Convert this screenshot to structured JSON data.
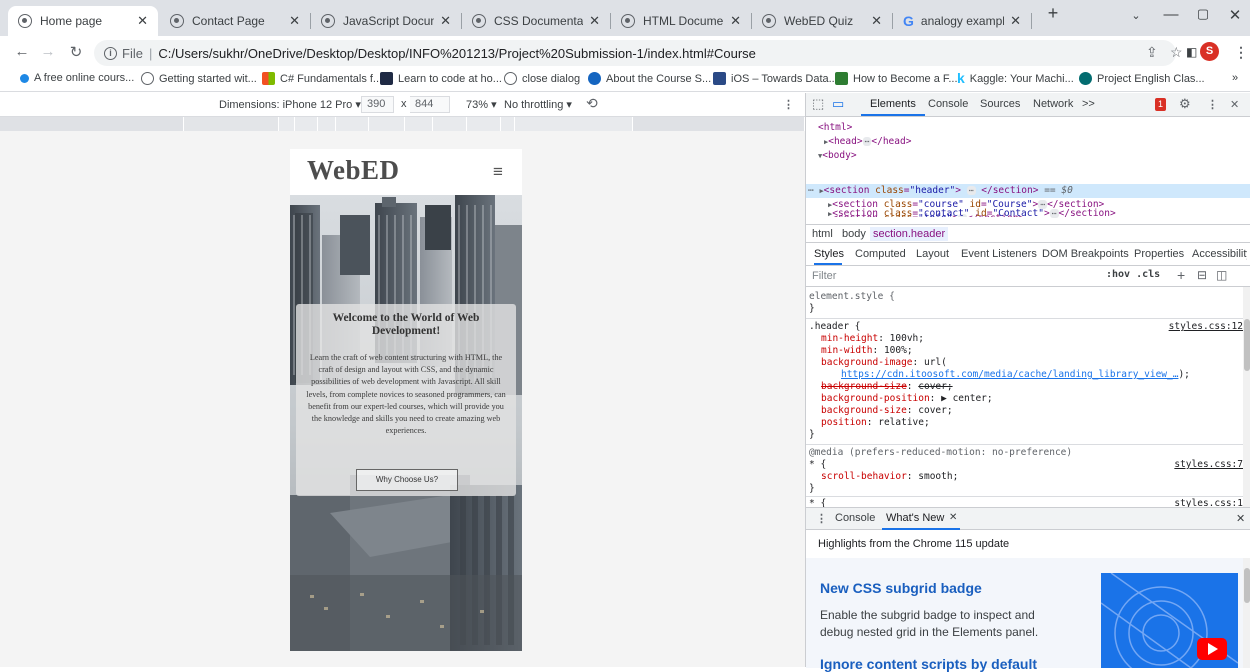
{
  "browser": {
    "tabs": [
      {
        "title": "Home page",
        "active": true
      },
      {
        "title": "Contact Page"
      },
      {
        "title": "JavaScript Documentati"
      },
      {
        "title": "CSS Documentation"
      },
      {
        "title": "HTML Documentation"
      },
      {
        "title": "WebED Quiz"
      },
      {
        "title": "analogy examples - G"
      }
    ],
    "new_tab": "+",
    "address": {
      "prefix": "File",
      "separator": "|",
      "url": "C:/Users/sukhr/OneDrive/Desktop/Desktop/INFO%201213/Project%20Submission-1/index.html#Course"
    },
    "profile_initial": "S",
    "bookmarks": [
      "A free online cours...",
      "Getting started wit...",
      "C# Fundamentals f...",
      "Learn to code at ho...",
      "close dialog",
      "About the Course S...",
      "iOS – Towards Data...",
      "How to Become a F...",
      "Kaggle: Your Machi...",
      "Project English Clas..."
    ],
    "bookmarks_overflow": "»"
  },
  "device_toolbar": {
    "dimensions_label": "Dimensions: iPhone 12 Pro ▾",
    "width": "390",
    "times": "x",
    "height": "844",
    "zoom": "73% ▾",
    "throttling": "No throttling ▾"
  },
  "site": {
    "logo": "WebED",
    "menu_icon": "≡",
    "hero_title": "Welcome to the World of Web Development!",
    "hero_text": "Learn the craft of web content structuring with HTML, the craft of design and layout with CSS, and the dynamic possibilities of web development with Javascript. All skill levels, from complete novices to seasoned programmers, can benefit from our expert-led courses, which will provide you the knowledge and skills you need to create amazing web experiences.",
    "hero_button": "Why Choose Us?"
  },
  "devtools": {
    "tabs": [
      "Elements",
      "Console",
      "Sources",
      "Network",
      ">>"
    ],
    "error_count": "1",
    "dom": {
      "l1": "<html>",
      "l2a": "<head>",
      "l2b": "</head>",
      "l3": "<body>",
      "selected_tail": "== $0"
    },
    "breadcrumbs": [
      "html",
      "body",
      "section.header"
    ],
    "style_tabs": [
      "Styles",
      "Computed",
      "Layout",
      "Event Listeners",
      "DOM Breakpoints",
      "Properties",
      "Accessibility"
    ],
    "filter_placeholder": "Filter",
    "filter_tools": ":hov .cls",
    "rules": {
      "element_style": "element.style {",
      "close": "}",
      "header_selector": ".header {",
      "header_src": "styles.css:12",
      "p1n": "min-height",
      "p1v": "100vh;",
      "p2n": "min-width",
      "p2v": "100%;",
      "p3n": "background-image",
      "p3v": "url(",
      "url": "https://cdn.itoosoft.com/media/cache/landing_library_view_…",
      "url_end": ");",
      "p4n": "background-size",
      "p4v": "cover;",
      "p5n": "background-position",
      "p5v": "▶ center;",
      "p6n": "background-size",
      "p6v": "cover;",
      "p7n": "position",
      "p7v": "relative;",
      "media": "@media (prefers-reduced-motion: no-preference)",
      "star": "* {",
      "star_src": "styles.css:7",
      "p8n": "scroll-behavior",
      "p8v": "smooth;",
      "star2": "* {",
      "star2_src": "styles.css:1"
    },
    "drawer": {
      "console_tab": "Console",
      "whatsnew_tab": "What's New",
      "highlights": "Highlights from the Chrome 115 update",
      "feature1_title": "New CSS subgrid badge",
      "feature1_desc": "Enable the subgrid badge to inspect and debug nested grid in the Elements panel.",
      "feature2_title": "Ignore content scripts by default"
    }
  },
  "colors": {
    "accent": "#1a73e8",
    "selected_row": "#cfe8fc",
    "error": "#d93025"
  }
}
